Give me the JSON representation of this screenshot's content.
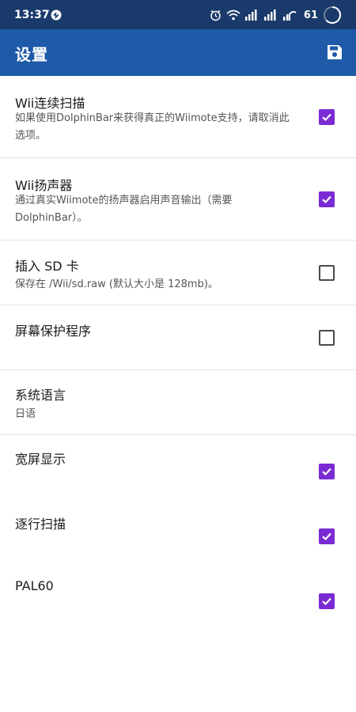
{
  "status_bar": {
    "time": "13:37",
    "battery": "61",
    "icons": [
      "alarm-icon",
      "wifi-icon",
      "signal-icon",
      "signal-icon",
      "signal-icon",
      "battery-ring-icon"
    ]
  },
  "app_bar": {
    "title": "设置",
    "save_icon": "save-icon"
  },
  "settings": [
    {
      "title": "Wii连续扫描",
      "summary": "如果使用DolphinBar来获得真正的Wiimote支持，请取消此选项。",
      "checked": true,
      "has_checkbox": true
    },
    {
      "title": "Wii扬声器",
      "summary": "通过真实Wiimote的扬声器启用声音输出（需要DolphinBar）。",
      "checked": true,
      "has_checkbox": true
    },
    {
      "title": "插入 SD 卡",
      "summary": "保存在 /Wii/sd.raw (默认大小是 128mb)。",
      "checked": false,
      "has_checkbox": true
    },
    {
      "title": "屏幕保护程序",
      "summary": "",
      "checked": false,
      "has_checkbox": true
    },
    {
      "title": "系统语言",
      "summary": "日语",
      "has_checkbox": false
    },
    {
      "title": "宽屏显示",
      "summary": "",
      "checked": true,
      "has_checkbox": true
    },
    {
      "title": "逐行扫描",
      "summary": "",
      "checked": true,
      "has_checkbox": true
    },
    {
      "title": "PAL60",
      "summary": "",
      "checked": true,
      "has_checkbox": true
    }
  ],
  "colors": {
    "status_bar": "#1a3a6b",
    "app_bar": "#1e5aa8",
    "checkbox_checked": "#7a2bd4"
  }
}
